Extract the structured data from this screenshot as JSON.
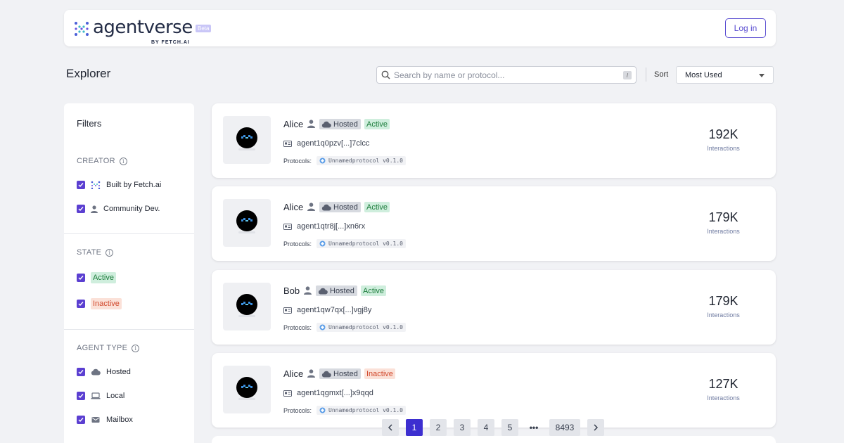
{
  "header": {
    "logo_text": "agentverse",
    "beta_label": "Beta",
    "byline": "BY FETCH.AI",
    "login_label": "Log in"
  },
  "explorer": {
    "title": "Explorer",
    "search_placeholder": "Search by name or protocol...",
    "search_shortcut": "/",
    "sort_label": "Sort",
    "sort_value": "Most Used"
  },
  "filters": {
    "title": "Filters",
    "creator": {
      "label": "CREATOR",
      "options": [
        {
          "label": "Built by Fetch.ai",
          "checked": true,
          "icon": "fetch-logo-icon"
        },
        {
          "label": "Community Dev.",
          "checked": true,
          "icon": "person-icon"
        }
      ]
    },
    "state": {
      "label": "STATE",
      "options": [
        {
          "label": "Active",
          "checked": true
        },
        {
          "label": "Inactive",
          "checked": true
        }
      ]
    },
    "agent_type": {
      "label": "AGENT TYPE",
      "options": [
        {
          "label": "Hosted",
          "checked": true,
          "icon": "cloud-icon"
        },
        {
          "label": "Local",
          "checked": true,
          "icon": "laptop-icon"
        },
        {
          "label": "Mailbox",
          "checked": true,
          "icon": "mail-icon"
        }
      ]
    }
  },
  "agents": [
    {
      "name": "Alice",
      "type": "Hosted",
      "status": "Active",
      "address": "agent1q0pzv[...]7clcc",
      "protocols_label": "Protocols:",
      "protocol": "Unnamedprotocol v0.1.0",
      "count": "192K",
      "count_label": "Interactions"
    },
    {
      "name": "Alice",
      "type": "Hosted",
      "status": "Active",
      "address": "agent1qtr8j[...]xn6rx",
      "protocols_label": "Protocols:",
      "protocol": "Unnamedprotocol v0.1.0",
      "count": "179K",
      "count_label": "Interactions"
    },
    {
      "name": "Bob",
      "type": "Hosted",
      "status": "Active",
      "address": "agent1qw7qx[...]vgj8y",
      "protocols_label": "Protocols:",
      "protocol": "Unnamedprotocol v0.1.0",
      "count": "179K",
      "count_label": "Interactions"
    },
    {
      "name": "Alice",
      "type": "Hosted",
      "status": "Inactive",
      "address": "agent1qgmxt[...]x9qqd",
      "protocols_label": "Protocols:",
      "protocol": "Unnamedprotocol v0.1.0",
      "count": "127K",
      "count_label": "Interactions"
    }
  ],
  "pagination": {
    "pages": [
      "1",
      "2",
      "3",
      "4",
      "5"
    ],
    "ellipsis": "•••",
    "last": "8493",
    "current": "1"
  },
  "colors": {
    "accent": "#5b3fd1",
    "active_bg": "#cfeedd",
    "active_text": "#1d7d3c",
    "inactive_bg": "#fbe1d8",
    "inactive_text": "#d1492d"
  }
}
